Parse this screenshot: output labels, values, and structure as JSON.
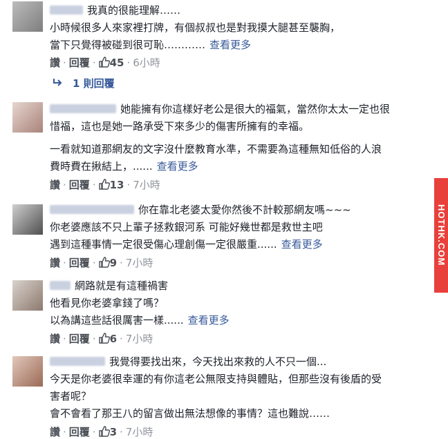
{
  "comments": [
    {
      "lines": [
        "我真的很能理解……",
        "小時候很多人來家裡打牌，有個叔叔也是對我摸大腿甚至襲胸，",
        "當下只覺得被碰到很可恥…………"
      ],
      "see_more": "查看更多",
      "like_label": "讚",
      "reply_label": "回覆",
      "likes": "45",
      "time": "6小時"
    },
    {
      "lines": [
        "她能擁有你這樣好老公是很大的福氣，當然你太太一定也很",
        "惜福，這也是她一路承受下來多少的傷害所擁有的幸福。",
        "",
        "一看就知道那網友的文字沒什麼教育水準，不需要為這種無知低俗的人浪",
        "費時費在揪結上，......"
      ],
      "see_more": "查看更多",
      "like_label": "讚",
      "reply_label": "回覆",
      "likes": "13",
      "time": "7小時"
    },
    {
      "lines": [
        "你在靠北老婆太愛你然後不計較那網友嗎~~~",
        "你老婆應該不只上輩子拯救銀河系 可能好幾世都是救世主吧",
        "遇到這種事情一定很受傷心理創傷一定很嚴重......"
      ],
      "see_more": "查看更多",
      "like_label": "讚",
      "reply_label": "回覆",
      "likes": "9",
      "time": "7小時"
    },
    {
      "lines": [
        "網路就是有這種禍害",
        "他看見你老婆拿錢了嗎？",
        "以為講這些話很厲害一樣......"
      ],
      "see_more": "查看更多",
      "like_label": "讚",
      "reply_label": "回覆",
      "likes": "6",
      "time": "7小時"
    },
    {
      "lines": [
        "我覺得要找出來，今天找出來救的人不只一個...",
        "今天是你老婆很幸運的有你這老公無限支持與體貼，但那些沒有後盾的受",
        "害者呢？",
        "會不會看了那王八的留言做出無法想像的事情？這也難說……"
      ],
      "like_label": "讚",
      "reply_label": "回覆",
      "likes": "3",
      "time": "7小時"
    }
  ],
  "replies_link": "1 則回覆",
  "watermark": "HOTHK.COM",
  "colors": {
    "link": "#365899",
    "text": "#1d2129",
    "meta": "#90949c",
    "watermark": "#e8403b"
  },
  "icons": [
    "thumbs-up-icon",
    "reply-arrow-icon"
  ]
}
